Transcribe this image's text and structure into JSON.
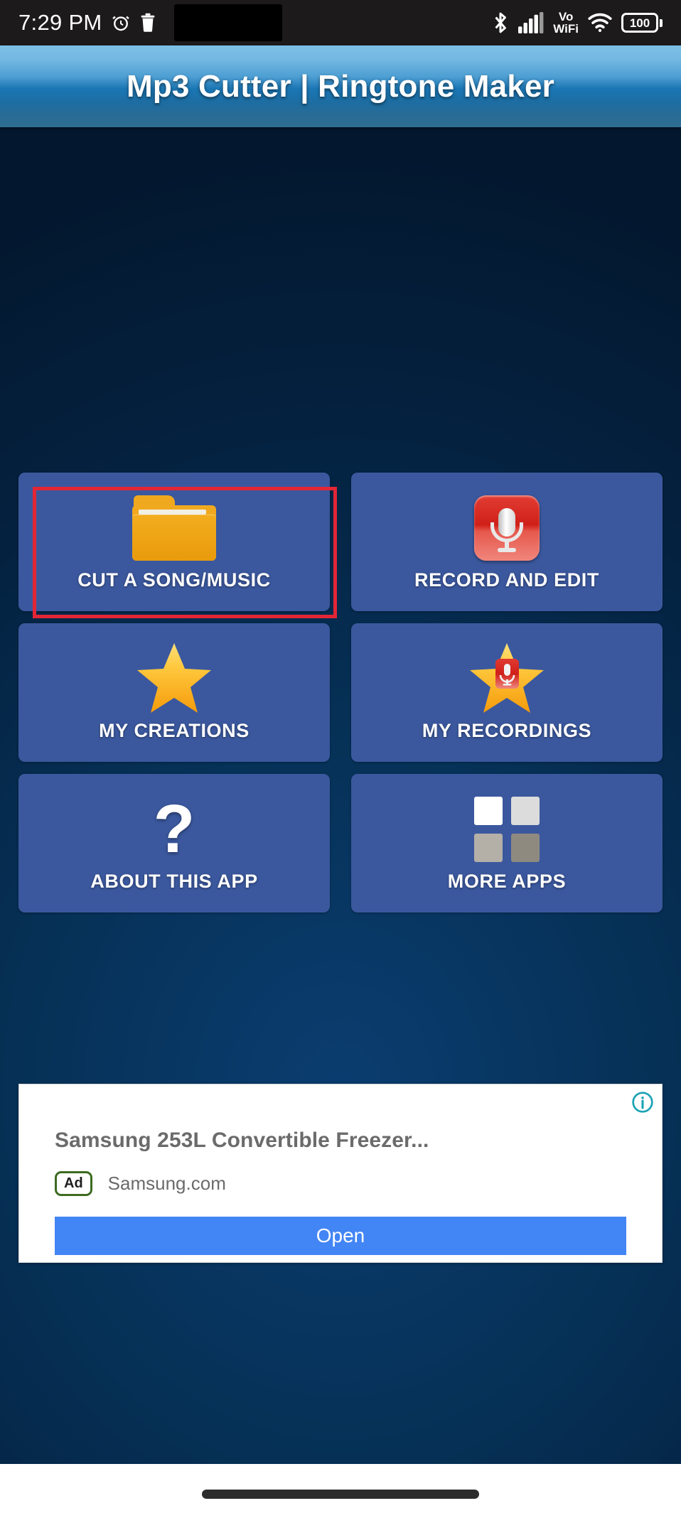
{
  "status_bar": {
    "time": "7:29 PM",
    "alarm_icon": "alarm-clock-icon",
    "trash_icon": "trash-icon",
    "bluetooth_icon": "bluetooth-icon",
    "signal_icon": "cellular-signal-icon",
    "volte_label_top": "Vo",
    "volte_label_bottom": "WiFi",
    "wifi_icon": "wifi-icon",
    "battery_level": "100"
  },
  "header": {
    "title": "Mp3 Cutter | Ringtone Maker"
  },
  "tiles": [
    {
      "label": "CUT A SONG/MUSIC",
      "icon": "folder-icon",
      "highlighted": true
    },
    {
      "label": "RECORD AND EDIT",
      "icon": "microphone-icon",
      "highlighted": false
    },
    {
      "label": "MY CREATIONS",
      "icon": "star-icon",
      "highlighted": false
    },
    {
      "label": "MY RECORDINGS",
      "icon": "star-microphone-icon",
      "highlighted": false
    },
    {
      "label": "ABOUT THIS APP",
      "icon": "question-mark-icon",
      "highlighted": false
    },
    {
      "label": "MORE APPS",
      "icon": "app-grid-icon",
      "highlighted": false
    }
  ],
  "ad": {
    "info_icon": "info-icon",
    "headline": "Samsung 253L Convertible Freezer...",
    "badge": "Ad",
    "domain": "Samsung.com",
    "cta": "Open"
  },
  "colors": {
    "tile": "#3b589e",
    "highlight": "#e32636",
    "title_bar_top": "#7cc0e6",
    "title_bar_bottom": "#2f6e93",
    "background": "#04213f",
    "ad_button": "#4285f4",
    "ad_badge_border": "#3c6b21",
    "info_icon": "#1aa3b5"
  },
  "nav": {
    "gesture_pill": "home-gesture-pill"
  }
}
